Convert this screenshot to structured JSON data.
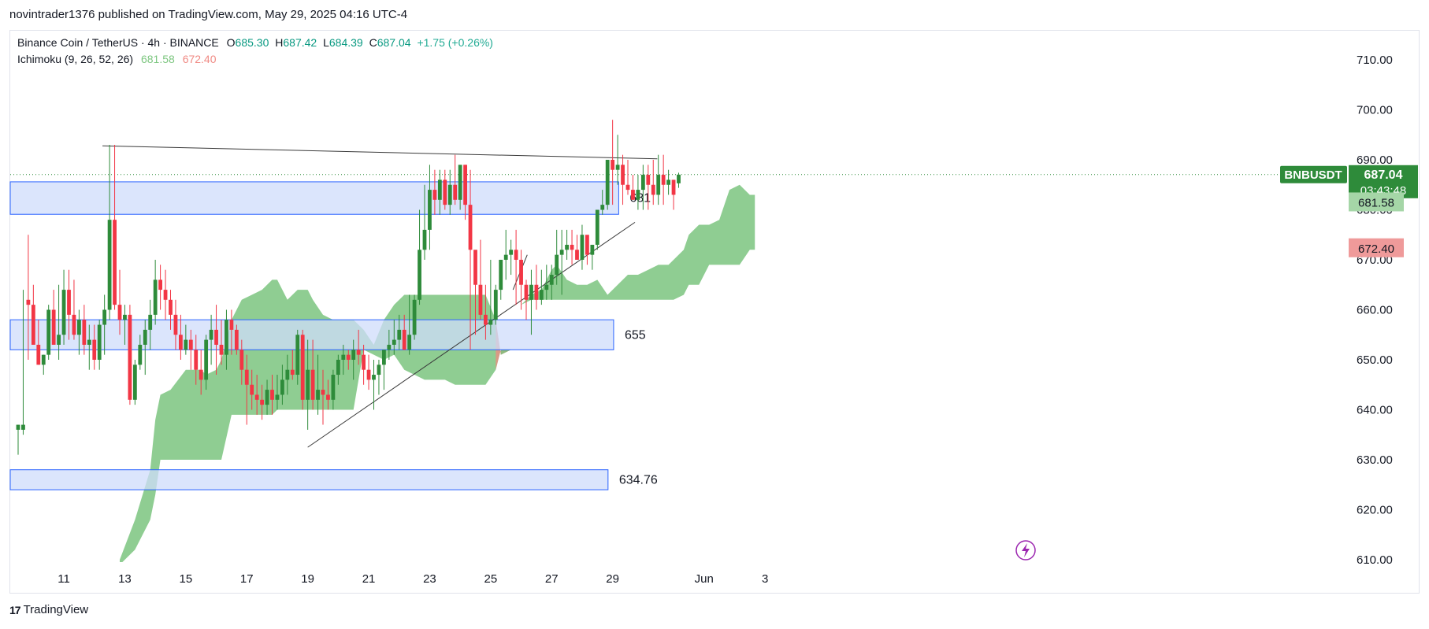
{
  "caption": "novintrader1376 published on TradingView.com, May 29, 2025 04:16 UTC-4",
  "legend": {
    "symbol": "Binance Coin / TetherUS · 4h · BINANCE",
    "o_label": "O",
    "o": "685.30",
    "h_label": "H",
    "h": "687.42",
    "l_label": "L",
    "l": "684.39",
    "c_label": "C",
    "c": "687.04",
    "change": "+1.75 (+0.26%)",
    "indicator": "Ichimoku (9, 26, 52, 26)",
    "span_a": "681.58",
    "span_b": "672.40"
  },
  "footer": {
    "logo_glyph": "17",
    "brand": "TradingView"
  },
  "colors": {
    "up": "#2e8b3a",
    "down": "#f23645",
    "cloud_bull": "#6fbf73",
    "cloud_bear": "#f7877f",
    "zone_fill": "#cfdcfb",
    "zone_border": "#2962ff",
    "price_tag": "#2e8b3a",
    "span_a_tag": "#a5d6a7",
    "span_b_tag": "#ef9a9a"
  },
  "chart_data": {
    "type": "candlestick",
    "symbol": "BNBUSDT",
    "timeframe": "4h",
    "ylim": [
      609,
      714
    ],
    "y_ticks": [
      610,
      620,
      630,
      640,
      650,
      660,
      670,
      680,
      690,
      700,
      710
    ],
    "y_tick_labels": [
      "610.00",
      "620.00",
      "630.00",
      "640.00",
      "650.00",
      "660.00",
      "670.00",
      "680.00",
      "690.00",
      "700.00",
      "710.00"
    ],
    "x_ticks": [
      {
        "label": "11",
        "bar": 10
      },
      {
        "label": "13",
        "bar": 22
      },
      {
        "label": "15",
        "bar": 34
      },
      {
        "label": "17",
        "bar": 46
      },
      {
        "label": "19",
        "bar": 58
      },
      {
        "label": "21",
        "bar": 70
      },
      {
        "label": "23",
        "bar": 82
      },
      {
        "label": "25",
        "bar": 94
      },
      {
        "label": "27",
        "bar": 106
      },
      {
        "label": "29",
        "bar": 118
      },
      {
        "label": "Jun",
        "bar": 136
      },
      {
        "label": "3",
        "bar": 148
      }
    ],
    "last_price": {
      "symbol": "BNBUSDT",
      "price": "687.04",
      "countdown": "03:43:48",
      "value": 687.04
    },
    "span_a_tag": {
      "label": "681.58",
      "value": 681.58
    },
    "span_b_tag": {
      "label": "672.40",
      "value": 672.4
    },
    "zones": [
      {
        "label": "681",
        "top": 685.6,
        "bottom": 679.1,
        "bar_end": 119.2
      },
      {
        "label": "655",
        "top": 658.0,
        "bottom": 652.0,
        "bar_end": 118.2
      },
      {
        "label": "634.76",
        "top": 628.0,
        "bottom": 624.0,
        "bar_end": 117.1
      }
    ],
    "trendlines": [
      {
        "from": [
          17.6,
          692.8
        ],
        "to": [
          126.8,
          690.2
        ]
      },
      {
        "from": [
          58.0,
          632.5
        ],
        "to": [
          122.4,
          677.5
        ]
      },
      {
        "from": [
          98.4,
          664.0
        ],
        "to": [
          101.2,
          671.0
        ]
      }
    ],
    "cloud_span_a": [
      [
        21,
        610
      ],
      [
        24,
        618
      ],
      [
        27,
        628
      ],
      [
        28,
        638
      ],
      [
        29,
        643
      ],
      [
        31,
        644
      ],
      [
        34,
        648
      ],
      [
        37,
        648
      ],
      [
        38,
        647
      ],
      [
        40,
        648
      ],
      [
        41,
        650
      ],
      [
        43,
        658
      ],
      [
        45,
        662
      ],
      [
        47,
        663
      ],
      [
        49,
        664
      ],
      [
        51,
        666
      ],
      [
        52,
        666
      ],
      [
        54,
        662
      ],
      [
        56,
        664
      ],
      [
        58,
        664
      ],
      [
        59,
        662
      ],
      [
        61,
        659
      ],
      [
        63,
        658
      ],
      [
        65,
        658
      ],
      [
        67,
        658
      ],
      [
        69,
        656
      ],
      [
        71,
        653
      ],
      [
        73,
        658
      ],
      [
        75,
        661
      ],
      [
        77,
        663
      ],
      [
        79,
        663
      ],
      [
        81,
        663
      ],
      [
        83,
        663
      ],
      [
        85,
        663
      ],
      [
        87,
        663
      ],
      [
        89,
        663
      ],
      [
        91,
        663
      ],
      [
        93,
        663
      ],
      [
        95,
        658
      ],
      [
        96,
        651
      ],
      [
        98,
        652
      ],
      [
        99,
        657
      ],
      [
        100,
        661
      ],
      [
        102,
        663
      ],
      [
        104,
        664
      ],
      [
        106,
        668
      ],
      [
        107,
        669
      ],
      [
        109,
        666
      ],
      [
        111,
        665
      ],
      [
        113,
        665
      ],
      [
        115,
        666
      ],
      [
        117,
        663
      ],
      [
        119,
        665
      ],
      [
        121,
        667
      ],
      [
        123,
        667
      ],
      [
        125,
        668
      ],
      [
        127,
        669
      ],
      [
        129,
        669
      ],
      [
        130,
        670
      ],
      [
        132,
        672
      ],
      [
        133,
        675
      ],
      [
        135,
        677
      ],
      [
        137,
        677
      ],
      [
        139,
        678
      ],
      [
        141,
        684
      ],
      [
        143,
        685
      ],
      [
        145,
        683
      ],
      [
        146,
        683
      ]
    ],
    "cloud_span_b": [
      [
        21,
        609
      ],
      [
        24,
        612
      ],
      [
        27,
        618
      ],
      [
        28,
        623
      ],
      [
        29,
        630
      ],
      [
        31,
        630
      ],
      [
        34,
        630
      ],
      [
        37,
        630
      ],
      [
        38,
        630
      ],
      [
        40,
        630
      ],
      [
        41,
        630
      ],
      [
        43,
        639
      ],
      [
        45,
        639
      ],
      [
        47,
        639
      ],
      [
        49,
        639
      ],
      [
        51,
        639
      ],
      [
        52,
        640
      ],
      [
        54,
        640
      ],
      [
        56,
        640
      ],
      [
        58,
        640
      ],
      [
        59,
        640
      ],
      [
        61,
        640
      ],
      [
        63,
        640
      ],
      [
        65,
        640
      ],
      [
        67,
        640
      ],
      [
        69,
        652
      ],
      [
        71,
        651
      ],
      [
        73,
        650
      ],
      [
        75,
        651
      ],
      [
        77,
        648
      ],
      [
        79,
        647
      ],
      [
        81,
        646
      ],
      [
        83,
        646
      ],
      [
        85,
        646
      ],
      [
        87,
        645
      ],
      [
        89,
        645
      ],
      [
        91,
        645
      ],
      [
        93,
        645
      ],
      [
        95,
        648
      ],
      [
        96,
        652
      ],
      [
        98,
        652
      ],
      [
        99,
        657
      ],
      [
        100,
        661
      ],
      [
        102,
        662
      ],
      [
        104,
        662
      ],
      [
        106,
        662
      ],
      [
        107,
        662
      ],
      [
        109,
        662
      ],
      [
        111,
        662
      ],
      [
        113,
        662
      ],
      [
        115,
        662
      ],
      [
        117,
        662
      ],
      [
        119,
        662
      ],
      [
        121,
        662
      ],
      [
        123,
        662
      ],
      [
        125,
        662
      ],
      [
        127,
        662
      ],
      [
        129,
        662
      ],
      [
        130,
        662
      ],
      [
        132,
        663
      ],
      [
        133,
        665
      ],
      [
        135,
        665
      ],
      [
        137,
        669
      ],
      [
        139,
        669
      ],
      [
        141,
        669
      ],
      [
        143,
        669
      ],
      [
        145,
        672
      ],
      [
        146,
        672
      ]
    ],
    "candles": [
      [
        636,
        637,
        631,
        637
      ],
      [
        636,
        664,
        635,
        637
      ],
      [
        662,
        675,
        650,
        661
      ],
      [
        661,
        665,
        655,
        653
      ],
      [
        653,
        658,
        649,
        649
      ],
      [
        649,
        651,
        647,
        651
      ],
      [
        651,
        661,
        650,
        660
      ],
      [
        660,
        664,
        657,
        653
      ],
      [
        653,
        665,
        650,
        655
      ],
      [
        655,
        668,
        653,
        664
      ],
      [
        664,
        668,
        654,
        659
      ],
      [
        659,
        666,
        654,
        655
      ],
      [
        655,
        660,
        651,
        658
      ],
      [
        658,
        661,
        651,
        653
      ],
      [
        653,
        657,
        648,
        654
      ],
      [
        654,
        657,
        648,
        650
      ],
      [
        650,
        658,
        648,
        657
      ],
      [
        657,
        663,
        651,
        660
      ],
      [
        660,
        693,
        658,
        678
      ],
      [
        678,
        693,
        660,
        661
      ],
      [
        661,
        668,
        655,
        658
      ],
      [
        658,
        661,
        653,
        659
      ],
      [
        659,
        661,
        641,
        642
      ],
      [
        642,
        650,
        641,
        649
      ],
      [
        649,
        655,
        648,
        653
      ],
      [
        653,
        658,
        647,
        656
      ],
      [
        656,
        662,
        652,
        659
      ],
      [
        659,
        670,
        657,
        666
      ],
      [
        666,
        669,
        660,
        664
      ],
      [
        664,
        668,
        658,
        662
      ],
      [
        662,
        664,
        656,
        659
      ],
      [
        659,
        662,
        652,
        655
      ],
      [
        655,
        659,
        650,
        652
      ],
      [
        652,
        657,
        651,
        654
      ],
      [
        654,
        656,
        648,
        652
      ],
      [
        652,
        655,
        645,
        648
      ],
      [
        648,
        652,
        643,
        646
      ],
      [
        646,
        655,
        644,
        654
      ],
      [
        654,
        659,
        649,
        656
      ],
      [
        656,
        661,
        647,
        653
      ],
      [
        653,
        658,
        649,
        651
      ],
      [
        651,
        660,
        648,
        658
      ],
      [
        658,
        660,
        651,
        656
      ],
      [
        656,
        657,
        651,
        652
      ],
      [
        652,
        654,
        645,
        648
      ],
      [
        648,
        651,
        637,
        645
      ],
      [
        645,
        648,
        640,
        643
      ],
      [
        643,
        647,
        639,
        642
      ],
      [
        642,
        645,
        638,
        641
      ],
      [
        641,
        646,
        639,
        644
      ],
      [
        644,
        647,
        639,
        642
      ],
      [
        642,
        647,
        640,
        643
      ],
      [
        643,
        649,
        641,
        646
      ],
      [
        646,
        651,
        643,
        648
      ],
      [
        648,
        652,
        646,
        647
      ],
      [
        647,
        656,
        645,
        655
      ],
      [
        655,
        656,
        640,
        642
      ],
      [
        642,
        654,
        636,
        648
      ],
      [
        648,
        654,
        640,
        642
      ],
      [
        642,
        651,
        639,
        644
      ],
      [
        644,
        648,
        637,
        643
      ],
      [
        643,
        646,
        640,
        642
      ],
      [
        642,
        648,
        640,
        647
      ],
      [
        647,
        651,
        645,
        650
      ],
      [
        650,
        653,
        647,
        651
      ],
      [
        651,
        652,
        648,
        650
      ],
      [
        650,
        654,
        646,
        652
      ],
      [
        652,
        656,
        649,
        651
      ],
      [
        651,
        653,
        645,
        648
      ],
      [
        648,
        651,
        644,
        646
      ],
      [
        646,
        650,
        640,
        647
      ],
      [
        647,
        650,
        643,
        649
      ],
      [
        649,
        651,
        644,
        652
      ],
      [
        652,
        656,
        650,
        653
      ],
      [
        653,
        658,
        651,
        654
      ],
      [
        654,
        659,
        652,
        656
      ],
      [
        656,
        659,
        652,
        652
      ],
      [
        652,
        663,
        651,
        655
      ],
      [
        655,
        663,
        654,
        662
      ],
      [
        662,
        680,
        661,
        672
      ],
      [
        672,
        685,
        670,
        676
      ],
      [
        676,
        689,
        672,
        684
      ],
      [
        684,
        688,
        679,
        682
      ],
      [
        682,
        688,
        679,
        686
      ],
      [
        686,
        688,
        680,
        681
      ],
      [
        681,
        688,
        679,
        685
      ],
      [
        685,
        691,
        681,
        682
      ],
      [
        682,
        688,
        680,
        689
      ],
      [
        689,
        689,
        678,
        681
      ],
      [
        681,
        688,
        652,
        672
      ],
      [
        672,
        671,
        655,
        665
      ],
      [
        665,
        674,
        658,
        659
      ],
      [
        659,
        665,
        654,
        657
      ],
      [
        657,
        670,
        655,
        658
      ],
      [
        658,
        665,
        657,
        664
      ],
      [
        664,
        670,
        662,
        670
      ],
      [
        670,
        676,
        666,
        671
      ],
      [
        671,
        674,
        667,
        672
      ],
      [
        672,
        676,
        661,
        670
      ],
      [
        670,
        672,
        660,
        665
      ],
      [
        665,
        666,
        658,
        662
      ],
      [
        662,
        668,
        655,
        665
      ],
      [
        665,
        669,
        660,
        662
      ],
      [
        662,
        668,
        661,
        664
      ],
      [
        664,
        669,
        662,
        665
      ],
      [
        665,
        669,
        662,
        667
      ],
      [
        667,
        676,
        665,
        671
      ],
      [
        671,
        676,
        663,
        672
      ],
      [
        672,
        676,
        670,
        673
      ],
      [
        673,
        676,
        669,
        672
      ],
      [
        672,
        675,
        670,
        670
      ],
      [
        670,
        677,
        668,
        675
      ],
      [
        675,
        674,
        669,
        671
      ],
      [
        671,
        673,
        668,
        673
      ],
      [
        673,
        679,
        672,
        680
      ],
      [
        680,
        684,
        679,
        681
      ],
      [
        681,
        690,
        680,
        690
      ],
      [
        690,
        698,
        681,
        688
      ],
      [
        688,
        695,
        685,
        689
      ],
      [
        689,
        691,
        681,
        685
      ],
      [
        685,
        690,
        683,
        684
      ],
      [
        684,
        687,
        682,
        682
      ],
      [
        682,
        687,
        680,
        684
      ],
      [
        684,
        689,
        680,
        687
      ],
      [
        687,
        689,
        680,
        685
      ],
      [
        685,
        690,
        681,
        683
      ],
      [
        683,
        691,
        681,
        687
      ],
      [
        687,
        691,
        681,
        685
      ],
      [
        685,
        688,
        683,
        686
      ],
      [
        686,
        686,
        680,
        683
      ],
      [
        685.3,
        687.42,
        684.39,
        687.04
      ]
    ]
  }
}
